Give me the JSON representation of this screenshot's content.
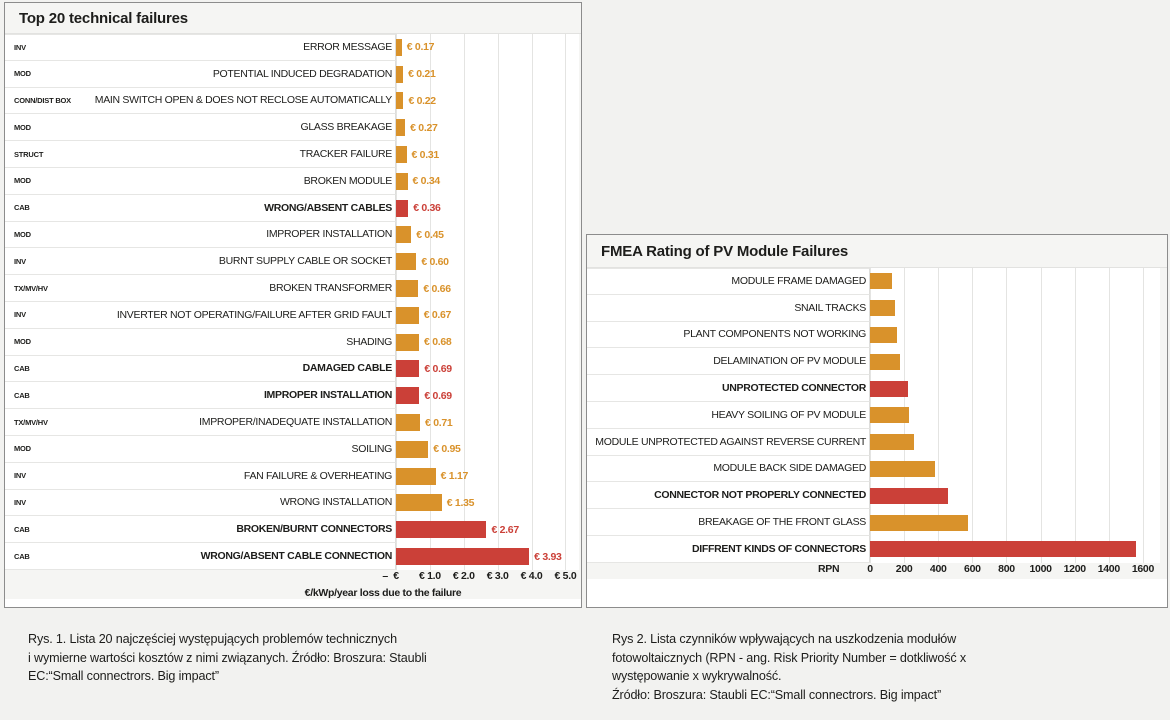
{
  "page": {
    "background": "#f2f2f0",
    "accent_orange": "#d9922b",
    "accent_red": "#cb4038"
  },
  "left_panel": {
    "title": "Top 20 technical failures"
  },
  "right_panel": {
    "title": "FMEA Rating of PV Module Failures"
  },
  "captions": {
    "left": {
      "l1": "Rys. 1. Lista 20 najczęściej występujących problemów technicznych",
      "l2": "i wymierne wartości kosztów z nimi związanych. Źródło: Broszura: Staubli",
      "l3": "EC:“Small connectrors. Big impact”"
    },
    "right": {
      "l1": "Rys 2. Lista czynników wpływających na uszkodzenia modułów",
      "l2": "fotowoltaicznych (RPN - ang. Risk Priority Number = dotkliwość x",
      "l3": "występowanie x wykrywalność.",
      "l4": "Źródło: Broszura: Staubli EC:“Small connectrors. Big impact”"
    }
  },
  "chart_data": [
    {
      "id": "top20",
      "type": "bar",
      "orientation": "horizontal",
      "title": "Top 20 technical failures",
      "xlabel": "€/kWp/year loss due to the failure",
      "ylabel": "",
      "xlim": [
        0,
        5.4
      ],
      "grid": true,
      "legend": "none",
      "tick_labels": [
        "–",
        "€",
        "€ 1.0",
        "€ 2.0",
        "€ 3.0",
        "€ 4.0",
        "€ 5.0"
      ],
      "tick_values": [
        -0.32,
        0,
        1.0,
        2.0,
        3.0,
        4.0,
        5.0
      ],
      "value_prefix": "€ ",
      "categories": [
        "ERROR MESSAGE",
        "POTENTIAL INDUCED DEGRADATION",
        "MAIN SWITCH OPEN & DOES NOT RECLOSE AUTOMATICALLY",
        "GLASS BREAKAGE",
        "TRACKER FAILURE",
        "BROKEN MODULE",
        "WRONG/ABSENT CABLES",
        "IMPROPER INSTALLATION",
        "BURNT SUPPLY CABLE OR SOCKET",
        "BROKEN TRANSFORMER",
        "INVERTER NOT OPERATING/FAILURE AFTER GRID FAULT",
        "SHADING",
        "DAMAGED CABLE",
        "IMPROPER INSTALLATION",
        "IMPROPER/INADEQUATE INSTALLATION",
        "SOILING",
        "FAN FAILURE & OVERHEATING",
        "WRONG INSTALLATION",
        "BROKEN/BURNT CONNECTORS",
        "WRONG/ABSENT CABLE CONNECTION"
      ],
      "groups": [
        "INV",
        "MOD",
        "CONN/DIST BOX",
        "MOD",
        "STRUCT",
        "MOD",
        "CAB",
        "MOD",
        "INV",
        "TX/MV/HV",
        "INV",
        "MOD",
        "CAB",
        "CAB",
        "TX/MV/HV",
        "MOD",
        "INV",
        "INV",
        "CAB",
        "CAB"
      ],
      "values": [
        0.17,
        0.21,
        0.22,
        0.27,
        0.31,
        0.34,
        0.36,
        0.45,
        0.6,
        0.66,
        0.67,
        0.68,
        0.69,
        0.69,
        0.71,
        0.95,
        1.17,
        1.35,
        2.67,
        3.93
      ],
      "value_labels": [
        "€ 0.17",
        "€ 0.21",
        "€ 0.22",
        "€ 0.27",
        "€ 0.31",
        "€ 0.34",
        "€ 0.36",
        "€ 0.45",
        "€ 0.60",
        "€ 0.66",
        "€ 0.67",
        "€ 0.68",
        "€ 0.69",
        "€ 0.69",
        "€ 0.71",
        "€ 0.95",
        "€ 1.17",
        "€ 1.35",
        "€ 2.67",
        "€ 3.93"
      ],
      "colors": [
        "#d9922b",
        "#d9922b",
        "#d9922b",
        "#d9922b",
        "#d9922b",
        "#d9922b",
        "#cb4038",
        "#d9922b",
        "#d9922b",
        "#d9922b",
        "#d9922b",
        "#d9922b",
        "#cb4038",
        "#cb4038",
        "#d9922b",
        "#d9922b",
        "#d9922b",
        "#d9922b",
        "#cb4038",
        "#cb4038"
      ]
    },
    {
      "id": "fmea",
      "type": "bar",
      "orientation": "horizontal",
      "title": "FMEA Rating of PV Module Failures",
      "xlabel": "RPN",
      "ylabel": "",
      "xlim": [
        0,
        1700
      ],
      "grid": true,
      "legend": "none",
      "tick_labels": [
        "0",
        "200",
        "400",
        "600",
        "800",
        "1000",
        "1200",
        "1400",
        "1600"
      ],
      "tick_values": [
        0,
        200,
        400,
        600,
        800,
        1000,
        1200,
        1400,
        1600
      ],
      "categories": [
        "MODULE FRAME DAMAGED",
        "SNAIL TRACKS",
        "PLANT COMPONENTS NOT WORKING",
        "DELAMINATION OF PV MODULE",
        "UNPROTECTED CONNECTOR",
        "HEAVY SOILING OF PV MODULE",
        "MODULE UNPROTECTED AGAINST REVERSE CURRENT",
        "MODULE BACK SIDE DAMAGED",
        "CONNECTOR NOT PROPERLY CONNECTED",
        "BREAKAGE OF THE FRONT GLASS",
        "DIFFRENT KINDS OF CONNECTORS"
      ],
      "values": [
        128,
        148,
        160,
        175,
        220,
        228,
        260,
        380,
        460,
        575,
        1560
      ],
      "colors": [
        "#d9922b",
        "#d9922b",
        "#d9922b",
        "#d9922b",
        "#cb4038",
        "#d9922b",
        "#d9922b",
        "#d9922b",
        "#cb4038",
        "#d9922b",
        "#cb4038"
      ]
    }
  ]
}
